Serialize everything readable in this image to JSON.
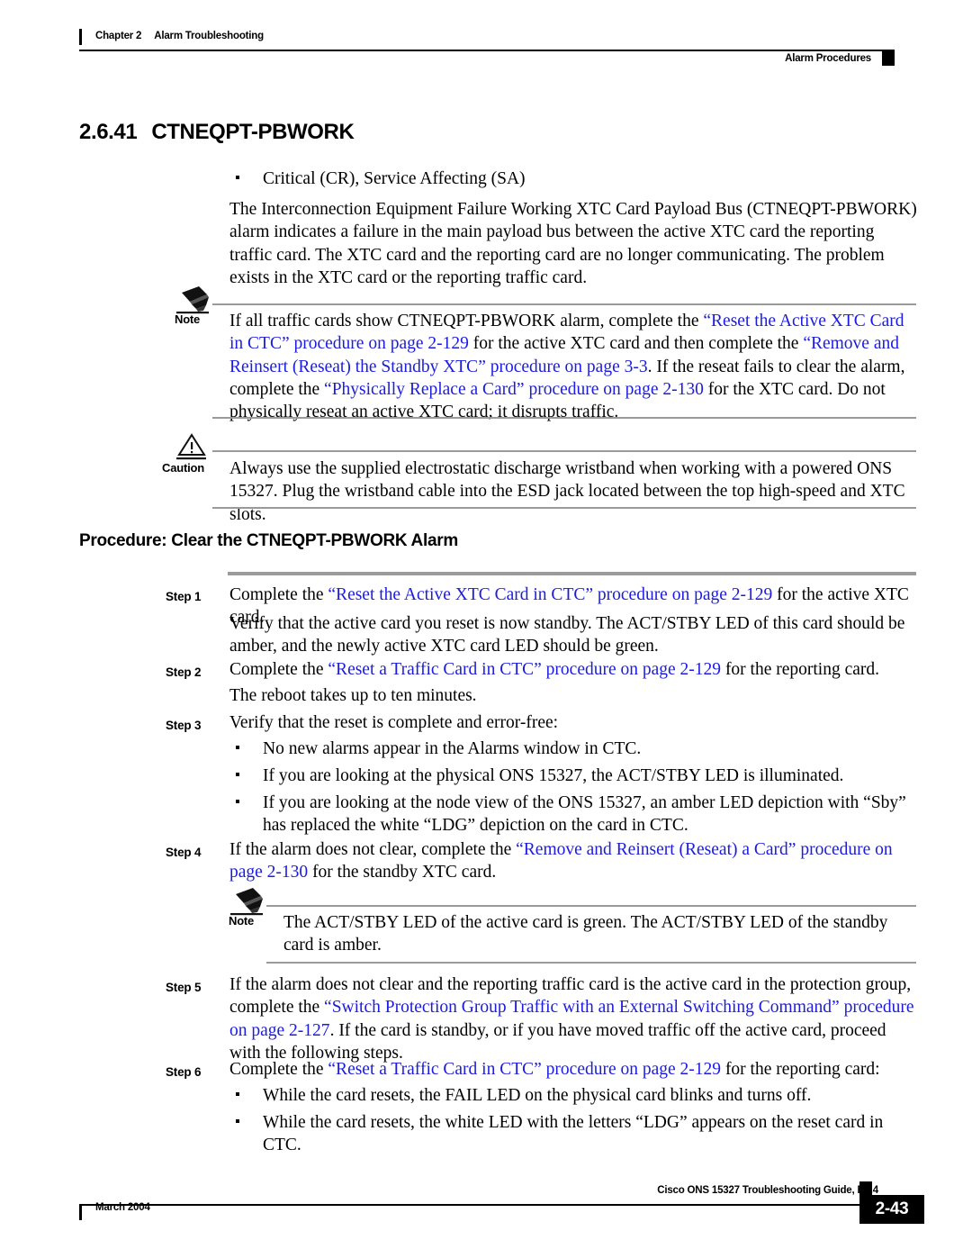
{
  "header": {
    "chapter_number": "Chapter 2",
    "chapter_title": "Alarm Troubleshooting",
    "section_running_head": "Alarm Procedures"
  },
  "section": {
    "number": "2.6.41",
    "title": "CTNEQPT-PBWORK",
    "severity_bullet": "Critical (CR), Service Affecting (SA)",
    "description": "The Interconnection Equipment Failure Working XTC Card Payload Bus (CTNEQPT-PBWORK) alarm indicates a failure in the main payload bus between the active XTC card the reporting traffic card. The XTC card and the reporting card are no longer communicating. The problem exists in the XTC card or the reporting traffic card."
  },
  "note1": {
    "label": "Note",
    "icon": "pencil-icon",
    "line1_pre": "If all traffic cards show CTNEQPT-PBWORK alarm, complete the ",
    "link1": "“Reset the Active XTC Card in CTC” procedure on page 2-129",
    "mid1": " for the active XTC card and then complete the ",
    "link2": "“Remove and Reinsert (Reseat) the Standby XTC” procedure on page 3-3",
    "mid2": ". If the reseat fails to clear the alarm, complete the ",
    "link3": "“Physically Replace a Card” procedure on page 2-130",
    "tail": " for the XTC card. Do not physically reseat an active XTC card; it disrupts traffic."
  },
  "caution": {
    "label": "Caution",
    "icon": "warning-triangle-icon",
    "text": "Always use the supplied electrostatic discharge wristband when working with a powered ONS 15327. Plug the wristband cable into the ESD jack located between the top high-speed and XTC slots."
  },
  "procedure": {
    "heading_prefix": "Procedure:",
    "heading_title": "Clear the CTNEQPT-PBWORK Alarm"
  },
  "steps": [
    {
      "label": "Step 1",
      "pre": "Complete the ",
      "link": "“Reset the Active XTC Card in CTC” procedure on page 2-129",
      "post": " for the active XTC card.",
      "followup": "Verify that the active card you reset is now standby. The ACT/STBY LED of this card should be amber, and the newly active XTC card LED should be green."
    },
    {
      "label": "Step 2",
      "pre": "Complete the ",
      "link": "“Reset a Traffic Card in CTC” procedure on page 2-129",
      "post": " for the reporting card.",
      "followup": "The reboot takes up to ten minutes."
    },
    {
      "label": "Step 3",
      "pre": "Verify that the reset is complete and error-free:",
      "link": "",
      "post": "",
      "bullets": [
        "No new alarms appear in the Alarms window in CTC.",
        "If you are looking at the physical ONS 15327, the ACT/STBY LED is illuminated.",
        "If you are looking at the node view of the ONS 15327, an amber LED depiction with “Sby” has replaced the white “LDG” depiction on the card in CTC."
      ]
    },
    {
      "label": "Step 4",
      "pre": "If the alarm does not clear, complete the ",
      "link": "“Remove and Reinsert (Reseat) a Card” procedure on page 2-130",
      "post": " for the standby XTC card."
    },
    {
      "label": "Step 5",
      "pre": "If the alarm does not clear and the reporting traffic card is the active card in the protection group, complete the ",
      "link": "“Switch Protection Group Traffic with an External Switching Command” procedure on page 2-127",
      "post": ". If the card is standby, or if you have moved traffic off the active card, proceed with the following steps."
    },
    {
      "label": "Step 6",
      "pre": "Complete the ",
      "link": "“Reset a Traffic Card in CTC” procedure on page 2-129",
      "post": " for the reporting card:",
      "bullets": [
        "While the card resets, the FAIL LED on the physical card blinks and turns off.",
        "While the card resets, the white LED with the letters “LDG” appears on the reset card in CTC."
      ]
    }
  ],
  "note2": {
    "label": "Note",
    "icon": "pencil-icon",
    "text": "The ACT/STBY LED of the active card is green. The ACT/STBY LED of the standby card is amber."
  },
  "footer": {
    "guide_title": "Cisco ONS 15327 Troubleshooting Guide, R3.4",
    "date": "March 2004",
    "page_number": "2-43"
  },
  "colors": {
    "link_blue": "#1c1ce0",
    "rule_gray": "#9a9a9a"
  }
}
